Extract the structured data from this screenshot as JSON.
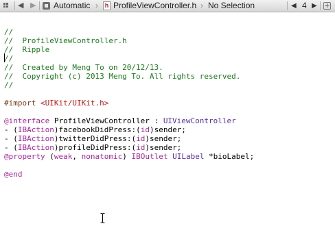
{
  "jumpbar": {
    "related_icon": "related-items-icon",
    "back_icon": "back-arrow-icon",
    "forward_icon": "forward-arrow-icon",
    "scheme": "Automatic",
    "file_icon": "header-file-icon",
    "file_icon_glyph": "h",
    "file": "ProfileViewController.h",
    "symbol": "No Selection",
    "issue_count": "4",
    "add_icon": "add-editor-icon",
    "add_glyph": "+"
  },
  "code": {
    "l1": "//",
    "l2": "//  ProfileViewController.h",
    "l3": "//  Ripple",
    "l4": "//",
    "l5": "//  Created by Meng To on 20/12/13.",
    "l6": "//  Copyright (c) 2013 Meng To. All rights reserved.",
    "l7": "//",
    "import_kw": "#import ",
    "import_file": "<UIKit/UIKit.h>",
    "interface_kw": "@interface",
    "class_name": " ProfileViewController : ",
    "superclass": "UIViewController",
    "action1_prefix": "- (",
    "ibaction": "IBAction",
    "action1_name": ")facebookDidPress:(",
    "id_kw": "id",
    "sender_tail": ")sender;",
    "action2_name": ")twitterDidPress:(",
    "action3_name": ")profileDidPress:(",
    "property_kw": "@property",
    "property_open": " (",
    "weak_kw": "weak",
    "comma": ", ",
    "nonatomic_kw": "nonatomic",
    "property_close": ") ",
    "iboutlet": "IBOutlet",
    "space": " ",
    "uilabel": "UILabel",
    "bio_label": " *bioLabel;",
    "end_kw": "@end"
  },
  "colors": {
    "comment": "#1d7a1d",
    "preprocessor": "#7a3e1d",
    "string": "#c41a16",
    "keyword": "#a52a9c",
    "type": "#5a2ea6"
  }
}
